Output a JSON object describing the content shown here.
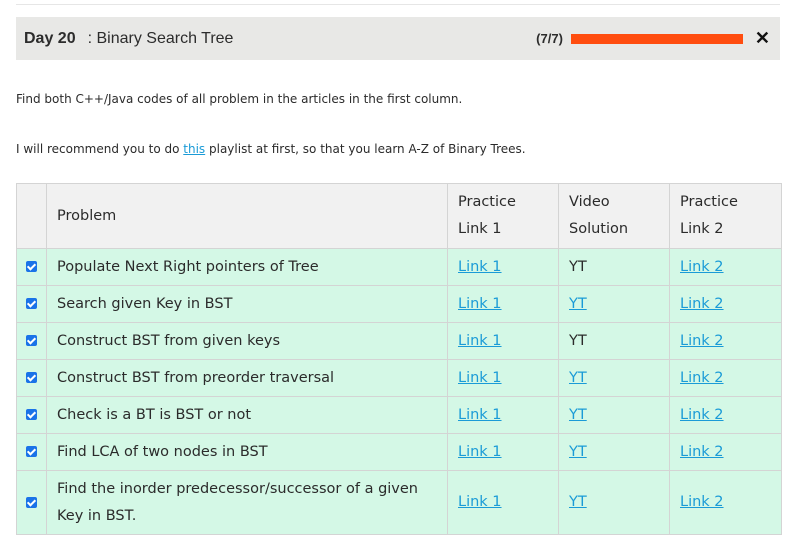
{
  "header": {
    "day": "Day 20",
    "topic": ": Binary Search Tree",
    "count": "(7/7)",
    "progress": 1.0,
    "close_icon": "close-x-icon",
    "progress_color": "#ff4d0f"
  },
  "intro": {
    "line1": "Find both C++/Java codes of all problem in the articles in the first column.",
    "line2_before": "I will recommend you to do ",
    "line2_link": "this",
    "line2_after": " playlist at first, so that you learn A-Z of Binary Trees."
  },
  "table": {
    "headers": [
      "Problem",
      "Practice Link 1",
      "Video Solution",
      "Practice Link 2"
    ],
    "rows": [
      {
        "checked": true,
        "problem": "Populate Next Right pointers of Tree",
        "link1": "Link 1",
        "video": "YT",
        "video_link": false,
        "link2": "Link 2"
      },
      {
        "checked": true,
        "problem": "Search given Key in BST",
        "link1": "Link 1",
        "video": "YT",
        "video_link": true,
        "link2": "Link 2"
      },
      {
        "checked": true,
        "problem": "Construct BST from given keys",
        "link1": "Link 1",
        "video": "YT",
        "video_link": false,
        "link2": "Link 2"
      },
      {
        "checked": true,
        "problem": "Construct BST from preorder traversal",
        "link1": "Link 1",
        "video": "YT",
        "video_link": true,
        "link2": "Link 2"
      },
      {
        "checked": true,
        "problem": "Check is a BT is BST or not",
        "link1": "Link 1",
        "video": "YT",
        "video_link": true,
        "link2": "Link 2"
      },
      {
        "checked": true,
        "problem": "Find LCA of two nodes in BST",
        "link1": "Link 1",
        "video": "YT",
        "video_link": true,
        "link2": "Link 2"
      },
      {
        "checked": true,
        "problem": "Find the inorder predecessor/successor of a given Key in BST.",
        "link1": "Link 1",
        "video": "YT",
        "video_link": true,
        "link2": "Link 2"
      }
    ]
  },
  "colors": {
    "row_bg": "#d4f8e6",
    "header_bg": "#f1f1f1",
    "link": "#1a9bd7",
    "checkbox": "#1a73e8"
  }
}
